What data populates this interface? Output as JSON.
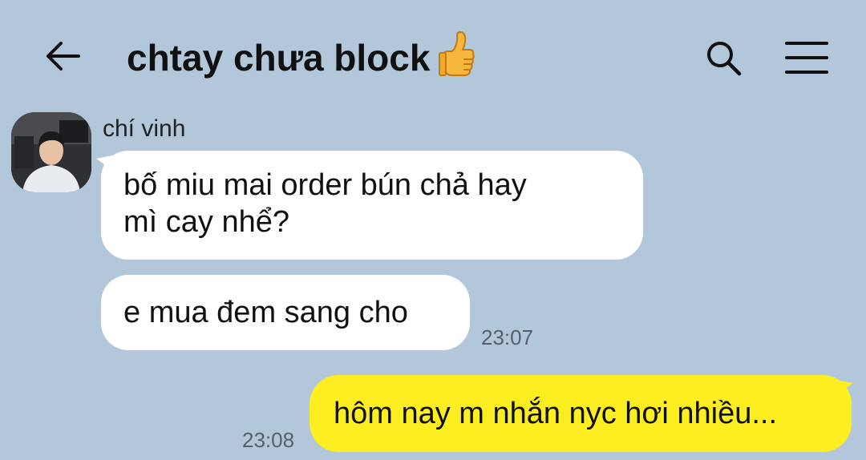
{
  "header": {
    "title": "chtay chưa block",
    "title_emoji": "thumbs-up-emoji",
    "back_icon": "arrow-left-icon",
    "search_icon": "search-icon",
    "menu_icon": "hamburger-menu-icon"
  },
  "messages": [
    {
      "direction": "incoming",
      "sender": "chí vinh",
      "lines": [
        "bố miu mai order bún chả hay",
        "mì cay nhể?"
      ]
    },
    {
      "direction": "incoming",
      "text": "e mua đem sang cho",
      "time": "23:07"
    },
    {
      "direction": "outgoing",
      "text": "hôm nay m nhắn nyc hơi nhiều...",
      "time": "23:08"
    }
  ],
  "colors": {
    "background": "#b2c7da",
    "incoming_bubble": "#ffffff",
    "outgoing_bubble": "#fcee21",
    "timestamp": "#56606b"
  }
}
